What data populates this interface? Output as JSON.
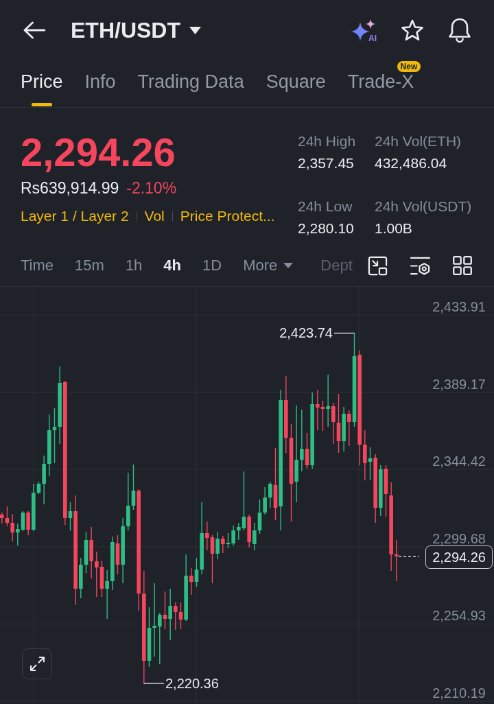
{
  "header": {
    "title": "ETH/USDT",
    "ai_button": "AI"
  },
  "tabs": [
    {
      "label": "Price",
      "selected": true
    },
    {
      "label": "Info",
      "selected": false
    },
    {
      "label": "Trading Data",
      "selected": false
    },
    {
      "label": "Square",
      "selected": false
    },
    {
      "label": "Trade-X",
      "selected": false,
      "badge": "New"
    }
  ],
  "ticker": {
    "price": "2,294.26",
    "fiat_price": "Rs639,914.99",
    "change": "-2.10%",
    "tags": [
      "Layer 1 / Layer 2",
      "Vol",
      "Price Protect..."
    ],
    "stats": [
      {
        "label": "24h High",
        "value": "2,357.45"
      },
      {
        "label": "24h Vol(ETH)",
        "value": "432,486.04"
      },
      {
        "label": "24h Low",
        "value": "2,280.10"
      },
      {
        "label": "24h Vol(USDT)",
        "value": "1.00B"
      }
    ]
  },
  "intervals": [
    {
      "label": "Time",
      "kind": "interval",
      "selected": false
    },
    {
      "label": "15m",
      "kind": "interval",
      "selected": false
    },
    {
      "label": "1h",
      "kind": "interval",
      "selected": false
    },
    {
      "label": "4h",
      "kind": "interval",
      "selected": true
    },
    {
      "label": "1D",
      "kind": "interval",
      "selected": false
    },
    {
      "label": "More",
      "kind": "dropdown",
      "selected": false
    },
    {
      "label": "Dept",
      "kind": "cut",
      "selected": false
    }
  ],
  "chart": {
    "high_label": "2,423.74",
    "current_price": "2,294.26",
    "low_label": "2,220.36",
    "chart_data": {
      "type": "candlestick",
      "grid": true,
      "categories": [
        null,
        null,
        null,
        null,
        null,
        null,
        null,
        null,
        null,
        null,
        null,
        null,
        null,
        null,
        null,
        null,
        null,
        null,
        null,
        null,
        null,
        null,
        null,
        null,
        null,
        null,
        null,
        null,
        null,
        null,
        null,
        null,
        null,
        null,
        null,
        null,
        null,
        null,
        null,
        null,
        null,
        null,
        null,
        null,
        null,
        null,
        null,
        null,
        null,
        null,
        null,
        null,
        null,
        null,
        null,
        null,
        null,
        null,
        null,
        null,
        null,
        null,
        null,
        null,
        null,
        null,
        null,
        null,
        null,
        null,
        null,
        null,
        null,
        null,
        null,
        null
      ],
      "ohlc": [
        [
          2318.28,
          2319.48,
          2313.12,
          2316.3
        ],
        [
          2316.3,
          2323.05,
          2311.53,
          2313.52
        ],
        [
          2313.52,
          2318.68,
          2302.79,
          2307.95
        ],
        [
          2307.95,
          2313.12,
          2300.4,
          2309.94
        ],
        [
          2309.54,
          2320.27,
          2308.75,
          2319.48
        ],
        [
          2319.48,
          2320.27,
          2306.36,
          2309.54
        ],
        [
          2309.54,
          2336.16,
          2308.75,
          2331.0
        ],
        [
          2331.0,
          2337.36,
          2330.2,
          2336.16
        ],
        [
          2336.16,
          2352.46,
          2324.24,
          2347.69
        ],
        [
          2347.69,
          2376.3,
          2340.54,
          2367.16
        ],
        [
          2367.16,
          2379.87,
          2348.09,
          2369.14
        ],
        [
          2369.14,
          2404.11,
          2359.21,
          2394.57
        ],
        [
          2394.97,
          2395.77,
          2312.32,
          2316.3
        ],
        [
          2316.3,
          2325.44,
          2309.15,
          2320.27
        ],
        [
          2320.27,
          2329.41,
          2265.84,
          2275.37
        ],
        [
          2275.37,
          2293.25,
          2269.81,
          2289.28
        ],
        [
          2289.28,
          2308.35,
          2284.51,
          2303.58
        ],
        [
          2303.58,
          2311.13,
          2281.33,
          2291.27
        ],
        [
          2291.27,
          2296.83,
          2270.6,
          2287.69
        ],
        [
          2288.09,
          2291.66,
          2270.6,
          2275.37
        ],
        [
          2275.37,
          2286.1,
          2257.89,
          2279.74
        ],
        [
          2279.74,
          2305.57,
          2274.58,
          2302.39
        ],
        [
          2301.6,
          2306.36,
          2283.72,
          2289.28
        ],
        [
          2289.28,
          2316.3,
          2278.55,
          2311.53
        ],
        [
          2311.53,
          2342.52,
          2309.15,
          2323.45
        ],
        [
          2323.45,
          2347.29,
          2321.07,
          2332.19
        ],
        [
          2332.19,
          2332.99,
          2262.66,
          2272.59
        ],
        [
          2272.59,
          2285.7,
          2220.36,
          2233.65
        ],
        [
          2233.65,
          2264.64,
          2230.08,
          2252.72
        ],
        [
          2252.72,
          2278.55,
          2236.04,
          2253.92
        ],
        [
          2253.52,
          2261.46,
          2231.66,
          2260.27
        ],
        [
          2260.27,
          2273.78,
          2251.93,
          2257.89
        ],
        [
          2257.89,
          2275.37,
          2245.57,
          2265.44
        ],
        [
          2265.44,
          2267.42,
          2251.53,
          2261.86
        ],
        [
          2261.86,
          2267.42,
          2251.93,
          2257.49
        ],
        [
          2257.49,
          2295.24,
          2256.7,
          2282.92
        ],
        [
          2282.92,
          2287.29,
          2271.8,
          2279.35
        ],
        [
          2279.35,
          2293.25,
          2276.56,
          2286.5
        ],
        [
          2286.5,
          2325.44,
          2283.72,
          2307.56
        ],
        [
          2307.56,
          2314.31,
          2297.62,
          2304.77
        ],
        [
          2305.17,
          2306.36,
          2278.55,
          2295.64
        ],
        [
          2295.64,
          2308.35,
          2292.46,
          2304.38
        ],
        [
          2304.38,
          2305.97,
          2296.03,
          2301.2
        ],
        [
          2301.2,
          2307.56,
          2298.81,
          2301.99
        ],
        [
          2301.6,
          2311.93,
          2300.4,
          2309.15
        ],
        [
          2309.15,
          2313.52,
          2303.58,
          2311.13
        ],
        [
          2310.34,
          2343.32,
          2309.15,
          2317.09
        ],
        [
          2317.09,
          2318.28,
          2299.21,
          2302.39
        ],
        [
          2301.2,
          2313.52,
          2297.62,
          2309.15
        ],
        [
          2309.15,
          2327.03,
          2307.16,
          2319.48
        ],
        [
          2319.48,
          2334.18,
          2318.28,
          2328.22
        ],
        [
          2328.22,
          2337.36,
          2322.26,
          2336.16
        ],
        [
          2335.37,
          2356.83,
          2315.11,
          2322.26
        ],
        [
          2323.05,
          2390.6,
          2309.15,
          2384.64
        ],
        [
          2384.64,
          2398.55,
          2354.05,
          2362.79
        ],
        [
          2362.79,
          2370.73,
          2314.31,
          2336.16
        ],
        [
          2337.36,
          2381.46,
          2325.44,
          2350.07
        ],
        [
          2350.07,
          2379.08,
          2343.32,
          2356.43
        ],
        [
          2356.43,
          2365.57,
          2344.91,
          2346.89
        ],
        [
          2346.89,
          2389.01,
          2344.91,
          2382.26
        ],
        [
          2382.26,
          2390.6,
          2367.16,
          2380.27
        ],
        [
          2380.67,
          2384.24,
          2366.76,
          2379.47
        ],
        [
          2379.47,
          2399.34,
          2369.14,
          2381.06
        ],
        [
          2381.06,
          2383.05,
          2359.21,
          2371.93
        ],
        [
          2371.53,
          2388.22,
          2354.05,
          2360.8
        ],
        [
          2360.8,
          2380.67,
          2354.84,
          2376.69
        ],
        [
          2376.69,
          2378.68,
          2358.02,
          2371.93
        ],
        [
          2371.93,
          2423.74,
          2369.14,
          2410.07
        ],
        [
          2410.86,
          2413.25,
          2346.89,
          2358.81
        ],
        [
          2358.81,
          2367.16,
          2338.15,
          2348.09
        ],
        [
          2348.88,
          2357.22,
          2338.15,
          2350.87
        ],
        [
          2351.26,
          2353.25,
          2313.52,
          2322.26
        ],
        [
          2322.26,
          2346.89,
          2317.49,
          2344.51
        ],
        [
          2344.91,
          2346.89,
          2317.09,
          2330.2
        ],
        [
          2329.41,
          2336.96,
          2285.7,
          2295.24
        ],
        [
          2295.24,
          2303.58,
          2279.74,
          2294.26
        ]
      ],
      "ylim": [
        2208.62,
        2450.2
      ],
      "yticks": [
        {
          "value": 2433.91,
          "label": "2,433.91"
        },
        {
          "value": 2389.17,
          "label": "2,389.17"
        },
        {
          "value": 2344.42,
          "label": "2,344.42"
        },
        {
          "value": 2299.68,
          "label": "2,299.68"
        },
        {
          "value": 2254.93,
          "label": "2,254.93"
        },
        {
          "value": 2210.19,
          "label": "2,210.19"
        }
      ]
    }
  }
}
